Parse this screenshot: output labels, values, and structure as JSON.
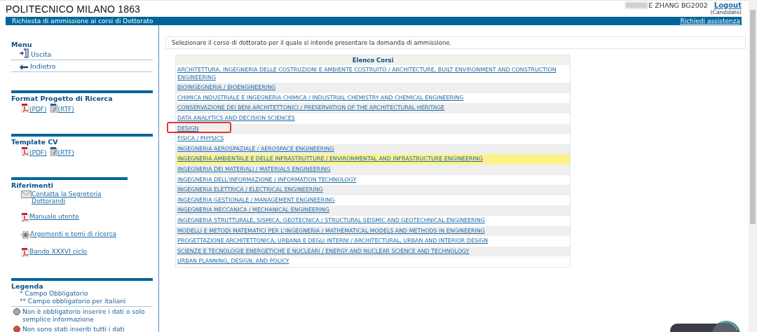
{
  "header": {
    "logo": "POLITECNICO MILANO 1863",
    "user": "E ZHANG BG2002",
    "logout": "Logout",
    "role": "(Candidato)"
  },
  "title_bar": {
    "title": "Richiesta di ammissione ai corsi di Dottorato",
    "help_link": "Richiedi assistenza"
  },
  "sidebar": {
    "menu": {
      "title": "Menu",
      "items": [
        {
          "kind": "exit",
          "label": "Uscita"
        },
        {
          "kind": "back",
          "label": "Indietro"
        }
      ]
    },
    "sections": [
      {
        "title": "Format Progetto di Ricerca",
        "kind": "inline",
        "links": [
          {
            "kind": "pdf",
            "label": "(PDF)"
          },
          {
            "kind": "rtf",
            "label": "(RTF)"
          }
        ]
      },
      {
        "title": "Template CV",
        "kind": "inline",
        "links": [
          {
            "kind": "pdf",
            "label": "(PDF)"
          },
          {
            "kind": "rtf",
            "label": "(RTF)"
          }
        ]
      },
      {
        "title": "Riferimenti",
        "kind": "list",
        "links": [
          {
            "kind": "mail",
            "label": " Contatta la Segreteria Dottorandi"
          },
          {
            "kind": "pdf",
            "label": "Manuale utente"
          },
          {
            "kind": "atom",
            "label": "Argomenti e temi di ricerca"
          },
          {
            "kind": "pdf",
            "label": "Bando XXXVI ciclo"
          }
        ]
      }
    ],
    "legend": {
      "title": "Legenda",
      "notes": [
        "* Campo Obbligatorio",
        "** Campo obbligatorio per italiani"
      ],
      "items": [
        {
          "color": "#a8a8a8",
          "text": "Non è obbligatorio inserire i dati o solo semplice informazione"
        },
        {
          "color": "#e8452c",
          "text": "Non sono stati inseriti tutti i dati"
        }
      ]
    }
  },
  "main": {
    "instruction": "Selezionare il corso di dottorato per il quale si intende presentare la domanda di ammissione.",
    "table": {
      "header": "Elenco Corsi",
      "rows": [
        {
          "label": "ARCHITETTURA, INGEGNERIA DELLE COSTRUZIONI E AMBIENTE COSTRUITO / ARCHITECTURE, BUILT ENVIRONMENT AND CONSTRUCTION ENGINEERING",
          "highlighted": false,
          "annotated": false
        },
        {
          "label": "BIOINGEGNERIA / BIOENGINEERING",
          "highlighted": false,
          "annotated": false
        },
        {
          "label": "CHIMICA INDUSTRIALE E INGEGNERIA CHIMICA / INDUSTRIAL CHEMISTRY AND CHEMICAL ENGINEERING",
          "highlighted": false,
          "annotated": false
        },
        {
          "label": "CONSERVAZIONE DEI BENI ARCHITETTONICI / PRESERVATION OF THE ARCHITECTURAL HERITAGE",
          "highlighted": false,
          "annotated": false
        },
        {
          "label": "DATA ANALYTICS AND DECISION SCIENCES",
          "highlighted": false,
          "annotated": false
        },
        {
          "label": "DESIGN",
          "highlighted": false,
          "annotated": true
        },
        {
          "label": "FISICA / PHYSICS",
          "highlighted": false,
          "annotated": false
        },
        {
          "label": "INGEGNERIA AEROSPAZIALE / AEROSPACE ENGINEERING",
          "highlighted": false,
          "annotated": false
        },
        {
          "label": "INGEGNERIA AMBIENTALE E DELLE INFRASTRUTTURE / ENVIRONMENTAL AND INFRASTRUCTURE ENGINEERING",
          "highlighted": true,
          "annotated": false
        },
        {
          "label": "INGEGNERIA DEI MATERIALI / MATERIALS ENGINEERING",
          "highlighted": false,
          "annotated": false
        },
        {
          "label": "INGEGNERIA DELL'INFORMAZIONE / INFORMATION TECHNOLOGY",
          "highlighted": false,
          "annotated": false
        },
        {
          "label": "INGEGNERIA ELETTRICA / ELECTRICAL ENGINEERING",
          "highlighted": false,
          "annotated": false
        },
        {
          "label": "INGEGNERIA GESTIONALE / MANAGEMENT ENGINEERING",
          "highlighted": false,
          "annotated": false
        },
        {
          "label": "INGEGNERIA MECCANICA / MECHANICAL ENGINEERING",
          "highlighted": false,
          "annotated": false
        },
        {
          "label": "INGEGNERIA STRUTTURALE, SISMICA, GEOTECNICA / STRUCTURAL SEISMIC AND GEOTECHNICAL ENGINEERING",
          "highlighted": false,
          "annotated": false
        },
        {
          "label": "MODELLI E METODI MATEMATICI PER L'INGEGNERIA / MATHEMATICAL MODELS AND METHODS IN ENGINEERING",
          "highlighted": false,
          "annotated": false
        },
        {
          "label": "PROGETTAZIONE ARCHITETTONICA, URBANA E DEGLI INTERNI / ARCHITECTURAL, URBAN AND INTERIOR DESIGN",
          "highlighted": false,
          "annotated": false
        },
        {
          "label": "SCIENZE E TECNOLOGIE ENERGETICHE E NUCLEARI / ENERGY AND NUCLEAR SCIENCE AND TECHNOLOGY",
          "highlighted": false,
          "annotated": false
        },
        {
          "label": "URBAN PLANNING, DESIGN, AND POLICY",
          "highlighted": false,
          "annotated": false
        }
      ]
    }
  }
}
